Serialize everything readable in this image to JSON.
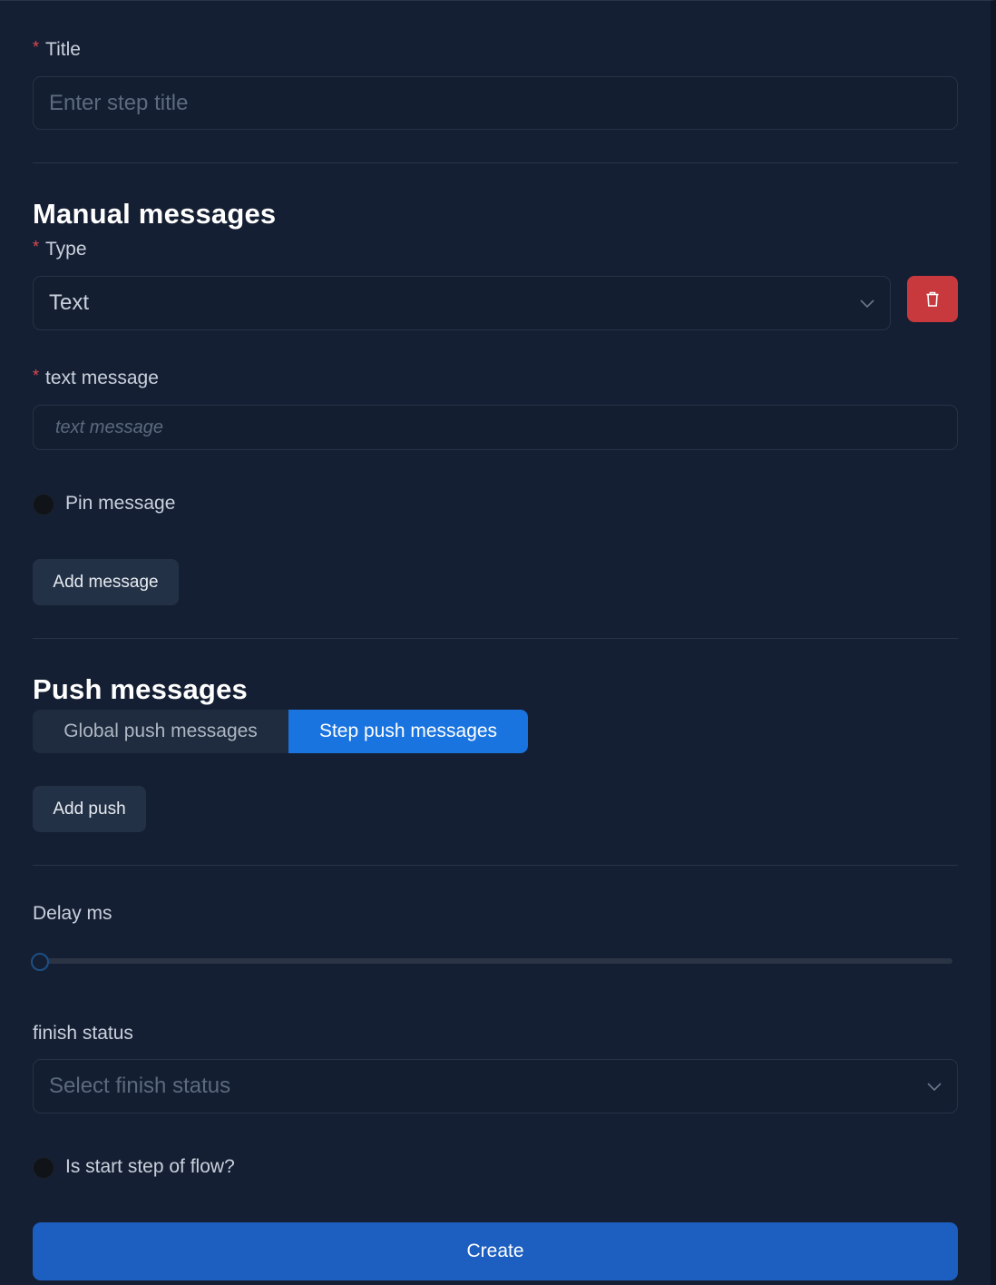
{
  "title_field": {
    "required_mark": "*",
    "label": "Title",
    "placeholder": "Enter step title",
    "value": ""
  },
  "manual_messages": {
    "heading": "Manual messages",
    "type_field": {
      "required_mark": "*",
      "label": "Type",
      "value": "Text"
    },
    "text_message_field": {
      "required_mark": "*",
      "label": "text message",
      "placeholder": "text message"
    },
    "pin_message_label": "Pin message",
    "pin_message_checked": false,
    "add_message_label": "Add message"
  },
  "push_messages": {
    "heading": "Push messages",
    "tabs": [
      {
        "label": "Global push messages",
        "active": false
      },
      {
        "label": "Step push messages",
        "active": true
      }
    ],
    "add_push_label": "Add push"
  },
  "delay": {
    "label": "Delay ms",
    "value": 0
  },
  "finish_status": {
    "label": "finish status",
    "placeholder": "Select finish status"
  },
  "start_step": {
    "label": "Is start step of flow?",
    "checked": false
  },
  "create_label": "Create",
  "colors": {
    "background": "#151f33",
    "primary": "#1a74e0",
    "danger": "#c8393d",
    "required": "#e0494f"
  },
  "icons": {
    "delete": "trash-icon",
    "dropdown": "chevron-down-icon"
  }
}
